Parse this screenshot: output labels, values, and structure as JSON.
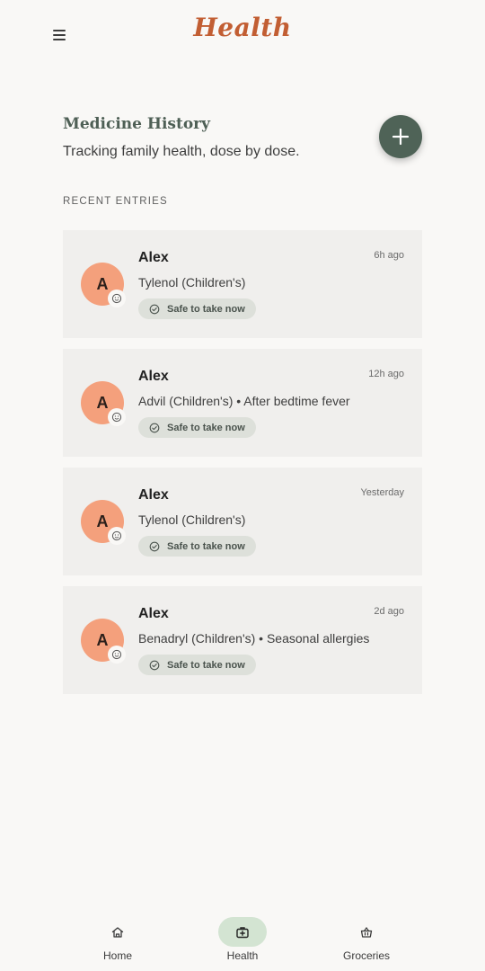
{
  "app": {
    "logo_text": "Health"
  },
  "header": {
    "title": "Medicine History",
    "subtitle": "Tracking family health, dose by dose."
  },
  "section_label": "RECENT ENTRIES",
  "entries": [
    {
      "initial": "A",
      "name": "Alex",
      "time": "6h ago",
      "description": "Tylenol (Children's)",
      "status": "Safe to take now"
    },
    {
      "initial": "A",
      "name": "Alex",
      "time": "12h ago",
      "description": "Advil (Children's) • After bedtime fever",
      "status": "Safe to take now"
    },
    {
      "initial": "A",
      "name": "Alex",
      "time": "Yesterday",
      "description": "Tylenol (Children's)",
      "status": "Safe to take now"
    },
    {
      "initial": "A",
      "name": "Alex",
      "time": "2d ago",
      "description": "Benadryl (Children's) • Seasonal allergies",
      "status": "Safe to take now"
    }
  ],
  "nav": {
    "items": [
      {
        "label": "Home",
        "icon": "home-icon",
        "active": false
      },
      {
        "label": "Health",
        "icon": "medical-kit-icon",
        "active": true
      },
      {
        "label": "Groceries",
        "icon": "basket-icon",
        "active": false
      }
    ]
  },
  "colors": {
    "background": "#f9f8f6",
    "logo": "#c25e33",
    "title": "#4e5f55",
    "fab": "#4f6357",
    "card": "#f0efed",
    "avatar": "#f4a07c",
    "status_pill": "#dde0da",
    "nav_active": "#d3e4d2"
  }
}
